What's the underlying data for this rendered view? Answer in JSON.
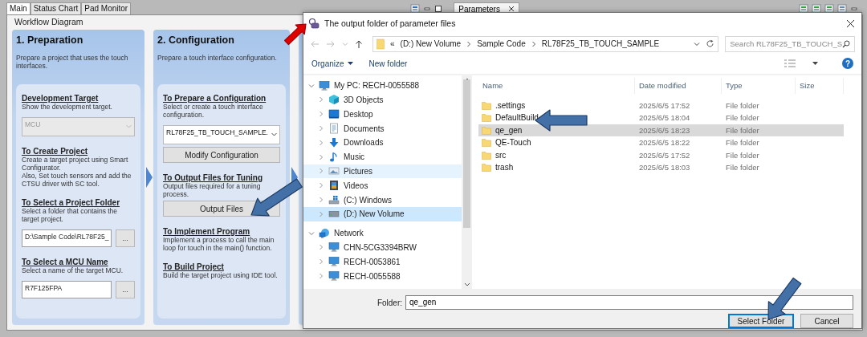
{
  "tabs": [
    {
      "label": "Main",
      "selected": true
    },
    {
      "label": "Status Chart",
      "selected": false
    },
    {
      "label": "Pad Monitor",
      "selected": false
    }
  ],
  "side_tabs": [
    {
      "label": "Parameters",
      "selected": true
    }
  ],
  "workflow": {
    "title": "Workflow Diagram",
    "steps": [
      {
        "title": "1. Preparation",
        "description": "Prepare a project that uses the touch interfaces.",
        "sections": [
          {
            "heading": "Development Target",
            "description": [
              "Show the development target."
            ],
            "controls": [
              {
                "kind": "dropdown",
                "value": "MCU",
                "disabled": true
              }
            ]
          },
          {
            "heading": "To Create Project",
            "description": [
              "Create a target project using Smart Configurator.",
              "Also, Set touch sensors and add the CTSU driver with SC tool."
            ]
          },
          {
            "heading": "To Select a Project Folder",
            "description": [
              "Select a folder that contains the target project."
            ],
            "controls": [
              {
                "kind": "field",
                "value": "D:\\Sample Code\\RL78F25_",
                "browse": "..."
              }
            ]
          },
          {
            "heading": "To Select a MCU Name",
            "description": [
              "Select a name of the target MCU."
            ],
            "controls": [
              {
                "kind": "field",
                "value": "R7F125FPA",
                "browse": "..."
              }
            ]
          }
        ]
      },
      {
        "title": "2. Configuration",
        "description": "Prepare a touch interface configuration.",
        "sections": [
          {
            "heading": "To Prepare a Configuration",
            "description": [
              "Select or create a touch interface configuration."
            ],
            "controls": [
              {
                "kind": "dropdown",
                "value": "RL78F25_TB_TOUCH_SAMPLE.",
                "disabled": false
              },
              {
                "kind": "button",
                "label": "Modify Configuration"
              }
            ]
          },
          {
            "heading": "To Output Files for Tuning",
            "description": [
              "Output files required for a tuning process."
            ],
            "controls": [
              {
                "kind": "button",
                "label": "Output Files"
              }
            ]
          },
          {
            "heading": "To Implement Program",
            "description": [
              "Implement a process to call the main loop for touch in the main() function."
            ]
          },
          {
            "heading": "To Build Project",
            "description": [
              "Build the target project using IDE tool."
            ]
          }
        ]
      }
    ]
  },
  "dialog": {
    "title": "The output folder of parameter files",
    "address": {
      "overflow": "«",
      "path": [
        "(D:) New Volume",
        "Sample Code",
        "RL78F25_TB_TOUCH_SAMPLE"
      ]
    },
    "search": {
      "placeholder": "Search RL78F25_TB_TOUCH_S"
    },
    "commands": [
      {
        "label": "Organize",
        "menu": true
      },
      {
        "label": "New folder",
        "menu": false
      }
    ],
    "help": "?",
    "nav": [
      {
        "label": "My PC: RECH-0055588",
        "kind": "computer",
        "expanded": true,
        "selected": false,
        "hovered": false,
        "children": [
          {
            "label": "3D Objects",
            "kind": "cube",
            "expanded": false,
            "selected": false,
            "hovered": false
          },
          {
            "label": "Desktop",
            "kind": "desktop",
            "expanded": false,
            "selected": false,
            "hovered": false
          },
          {
            "label": "Documents",
            "kind": "documents",
            "expanded": false,
            "selected": false,
            "hovered": false
          },
          {
            "label": "Downloads",
            "kind": "download",
            "expanded": false,
            "selected": false,
            "hovered": false
          },
          {
            "label": "Music",
            "kind": "music",
            "expanded": false,
            "selected": false,
            "hovered": false
          },
          {
            "label": "Pictures",
            "kind": "pictures",
            "expanded": false,
            "selected": false,
            "hovered": true
          },
          {
            "label": "Videos",
            "kind": "videos",
            "expanded": false,
            "selected": false,
            "hovered": false
          },
          {
            "label": "(C:) Windows",
            "kind": "system-drive",
            "expanded": false,
            "selected": false,
            "hovered": false
          },
          {
            "label": "(D:) New Volume",
            "kind": "drive",
            "expanded": false,
            "selected": true,
            "hovered": false
          }
        ]
      },
      {
        "label": "Network",
        "kind": "network",
        "expanded": true,
        "selected": false,
        "hovered": false,
        "children": [
          {
            "label": "CHN-5CG3394BRW",
            "kind": "computer",
            "expanded": false,
            "selected": false,
            "hovered": false
          },
          {
            "label": "RECH-0053861",
            "kind": "computer",
            "expanded": false,
            "selected": false,
            "hovered": false
          },
          {
            "label": "RECH-0055588",
            "kind": "computer",
            "expanded": false,
            "selected": false,
            "hovered": false
          }
        ]
      }
    ],
    "columns": [
      "Name",
      "Date modified",
      "Type",
      "Size"
    ],
    "files": [
      {
        "name": ".settings",
        "date": "2025/6/5 17:52",
        "type": "File folder",
        "selected": false
      },
      {
        "name": "DefaultBuild",
        "date": "2025/6/5 18:04",
        "type": "File folder",
        "selected": false
      },
      {
        "name": "qe_gen",
        "date": "2025/6/5 18:23",
        "type": "File folder",
        "selected": true
      },
      {
        "name": "QE-Touch",
        "date": "2025/6/5 18:22",
        "type": "File folder",
        "selected": false
      },
      {
        "name": "src",
        "date": "2025/6/5 17:52",
        "type": "File folder",
        "selected": false
      },
      {
        "name": "trash",
        "date": "2025/6/5 18:03",
        "type": "File folder",
        "selected": false
      }
    ],
    "folder": {
      "label": "Folder:",
      "value": "qe_gen"
    },
    "buttons": [
      {
        "label": "Select Folder",
        "default": true
      },
      {
        "label": "Cancel",
        "default": false
      }
    ]
  }
}
